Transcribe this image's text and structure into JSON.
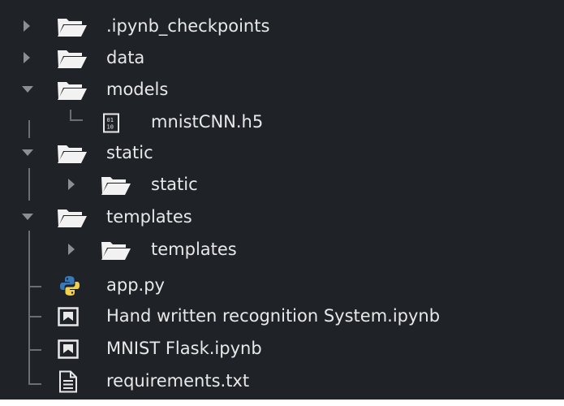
{
  "tree": {
    "items": [
      {
        "label": ".ipynb_checkpoints",
        "icon": "folder-icon",
        "state": "collapsed"
      },
      {
        "label": "data",
        "icon": "folder-icon",
        "state": "collapsed"
      },
      {
        "label": "models",
        "icon": "folder-icon",
        "state": "expanded"
      },
      {
        "label": "mnistCNN.h5",
        "icon": "binary-file-icon"
      },
      {
        "label": "static",
        "icon": "folder-icon",
        "state": "expanded"
      },
      {
        "label": "static",
        "icon": "folder-icon",
        "state": "collapsed"
      },
      {
        "label": "templates",
        "icon": "folder-icon",
        "state": "expanded"
      },
      {
        "label": "templates",
        "icon": "folder-icon",
        "state": "collapsed"
      },
      {
        "label": "app.py",
        "icon": "python-icon"
      },
      {
        "label": "Hand written recognition System.ipynb",
        "icon": "notebook-icon"
      },
      {
        "label": "MNIST Flask.ipynb",
        "icon": "notebook-icon"
      },
      {
        "label": "requirements.txt",
        "icon": "text-file-icon"
      }
    ]
  },
  "colors": {
    "background": "#1f2327",
    "text": "#e8e8e8",
    "chevron": "#8a8f94",
    "guide": "#6a6f74",
    "python_blue": "#3b78b8",
    "python_yellow": "#f3d04a"
  }
}
